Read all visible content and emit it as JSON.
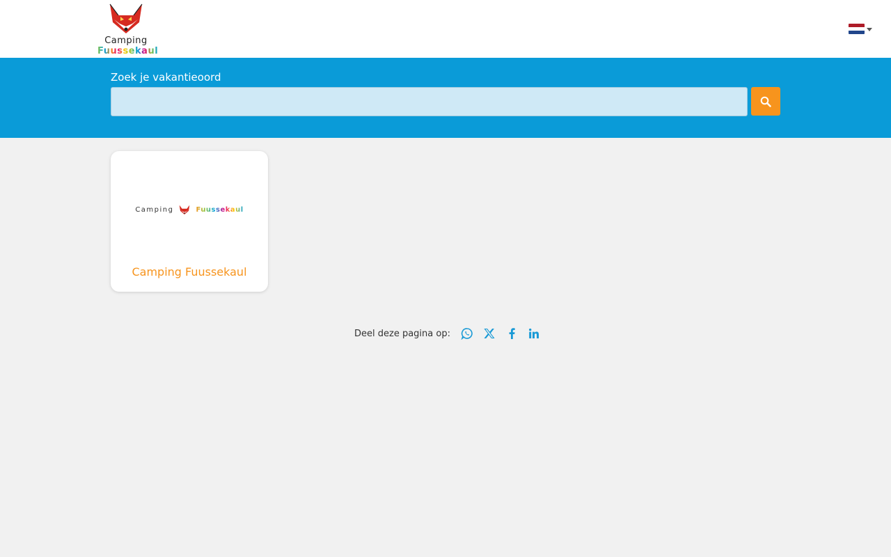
{
  "header": {
    "logo": {
      "line1": "Camping",
      "line2": "Fuussekaul",
      "icon": "fox-logo-icon"
    },
    "language": {
      "selected_icon": "flag-nl-icon",
      "flag_colors": [
        "#ae1c28",
        "#ffffff",
        "#21468b"
      ]
    }
  },
  "search": {
    "label": "Zoek je vakantieoord",
    "value": "",
    "button_icon": "search-icon"
  },
  "results": [
    {
      "title": "Camping Fuussekaul",
      "logo_text_1": "Camping",
      "logo_text_2": "Fuussekaul"
    }
  ],
  "share": {
    "label": "Deel deze pagina op:",
    "icons": [
      "whatsapp-icon",
      "x-icon",
      "facebook-icon",
      "linkedin-icon"
    ]
  },
  "colors": {
    "band": "#0a9bd8",
    "accent": "#f7941d",
    "icon": "#1a9ad6"
  }
}
